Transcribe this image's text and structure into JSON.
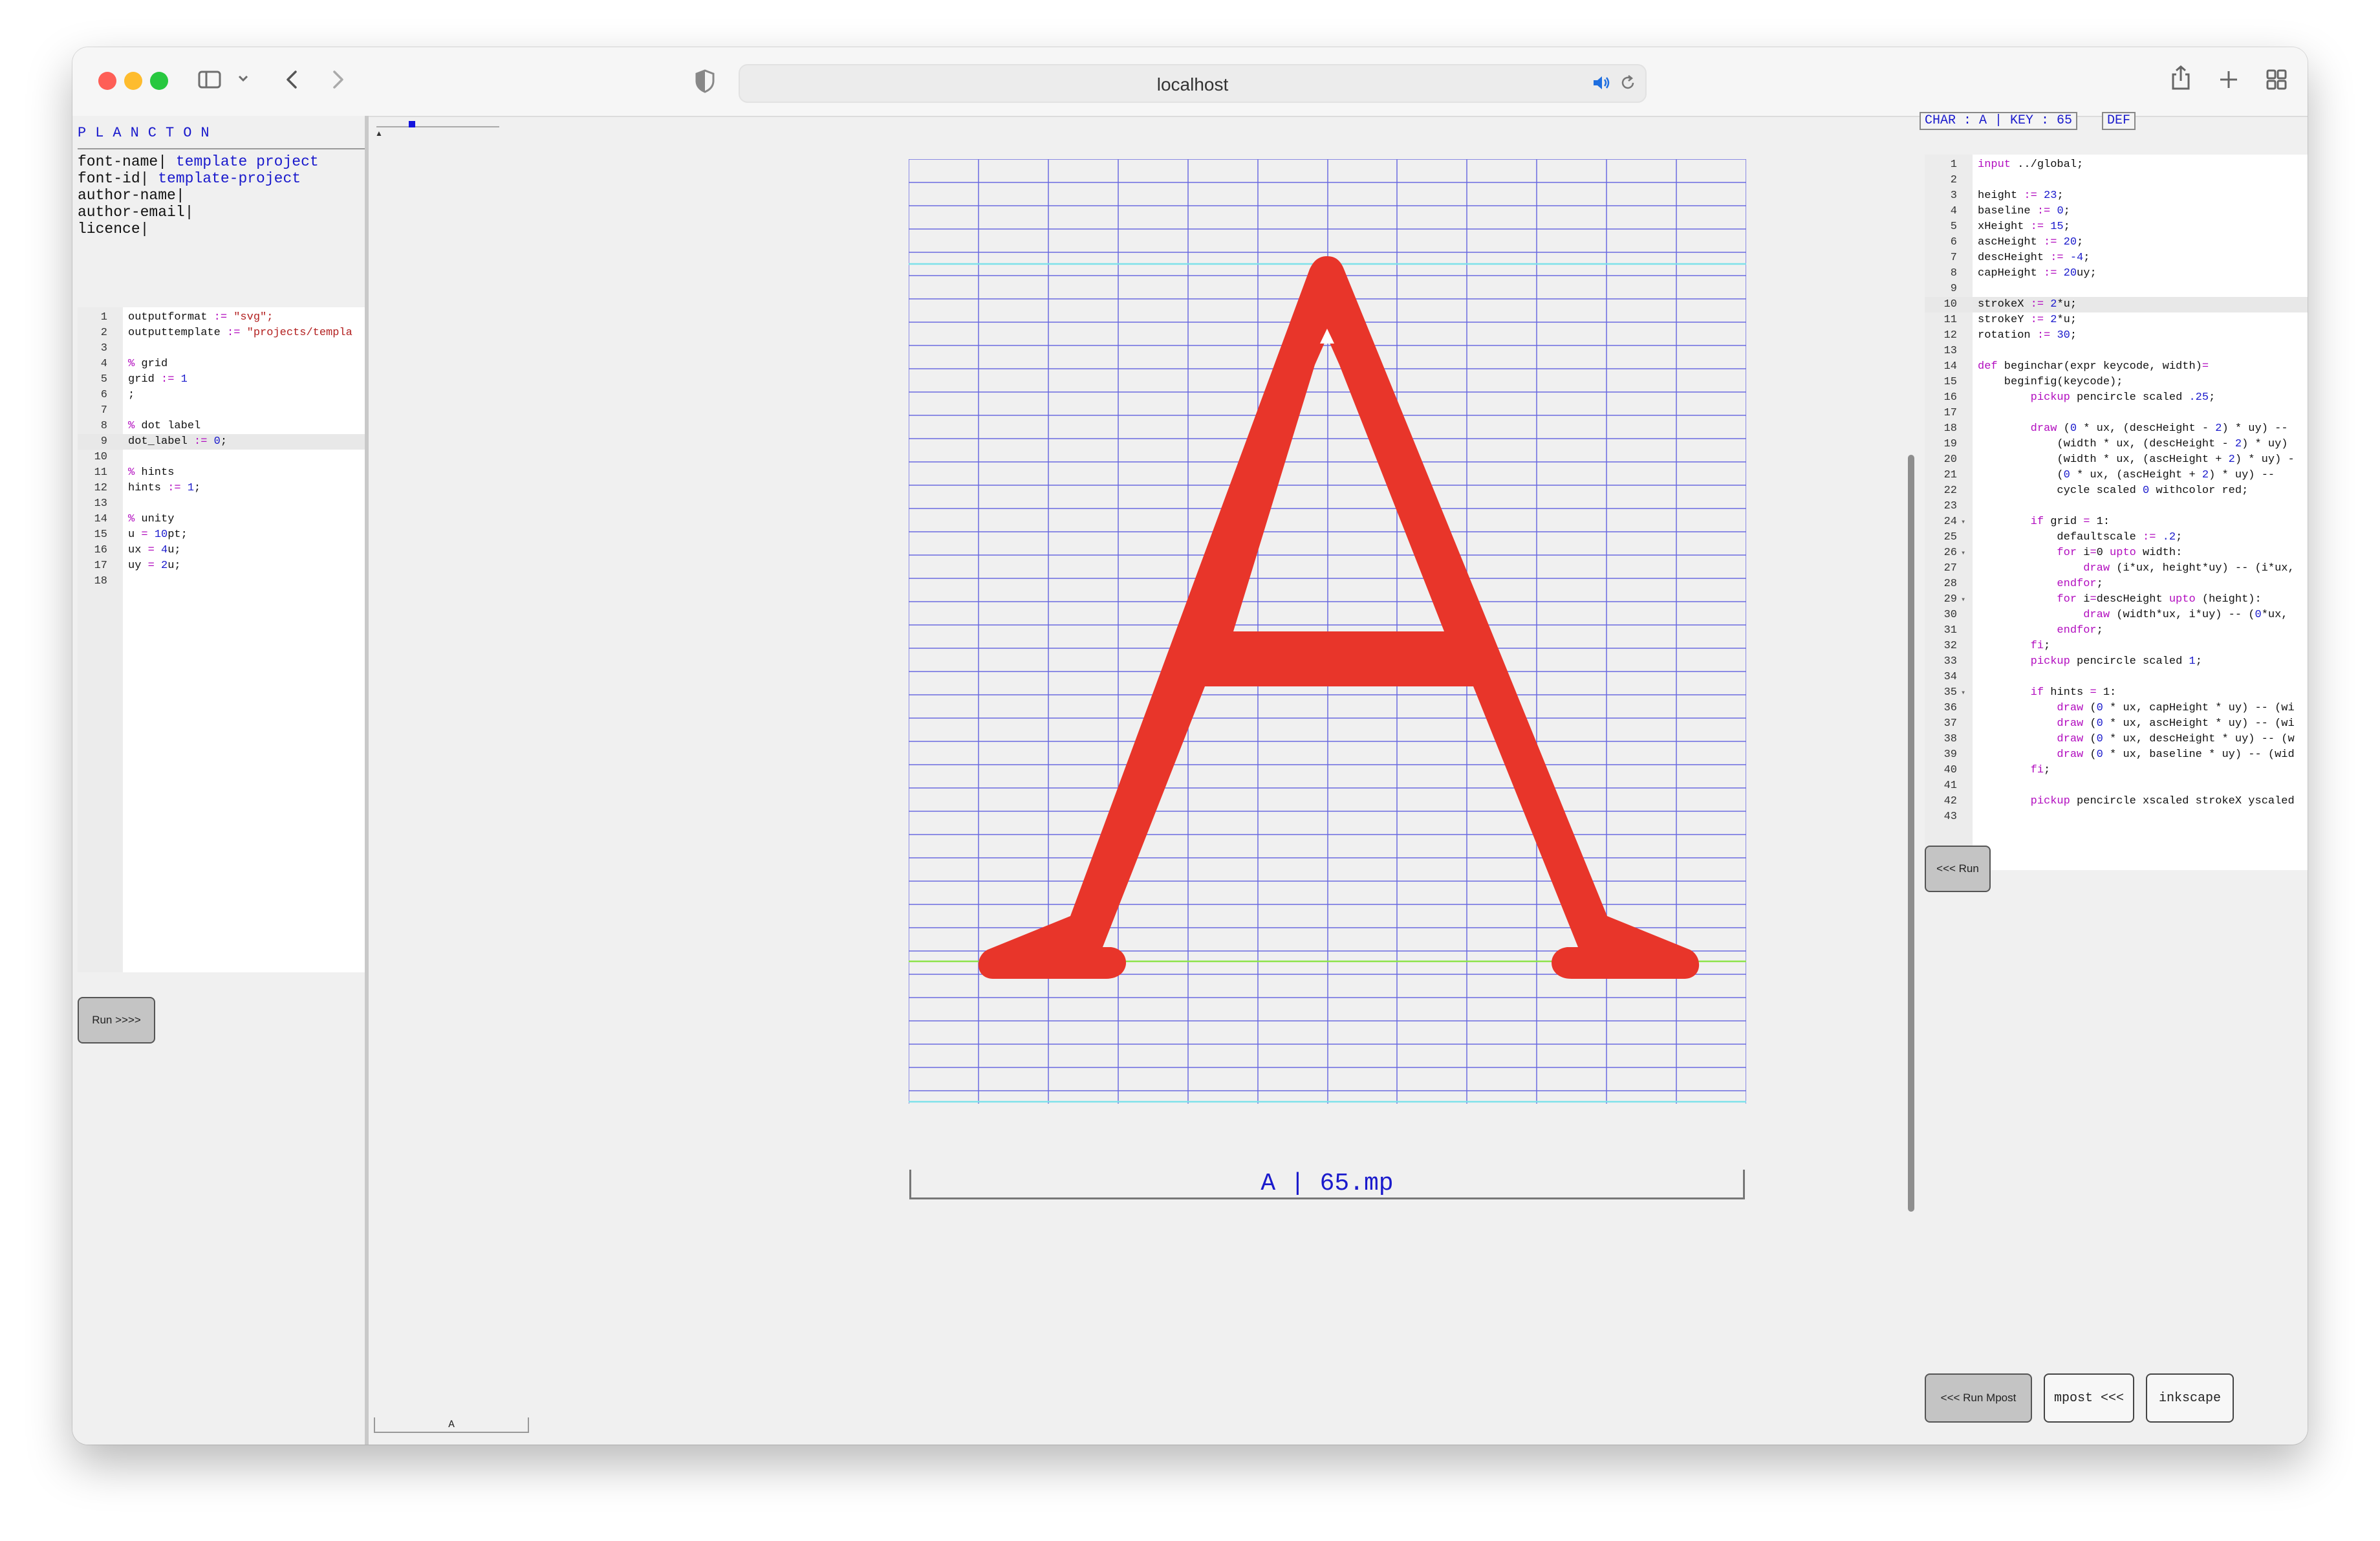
{
  "browser": {
    "url": "localhost",
    "icons": [
      "sidebar-icon",
      "chevron-down-icon",
      "back-icon",
      "forward-icon",
      "shield-icon",
      "audio-icon",
      "reload-icon",
      "share-icon",
      "new-tab-icon",
      "tabs-overview-icon"
    ]
  },
  "app": {
    "brand": "PLANCTON",
    "meta": [
      {
        "key": "font-name|",
        "value": "template project"
      },
      {
        "key": "font-id|",
        "value": "template-project"
      },
      {
        "key": "author-name|",
        "value": ""
      },
      {
        "key": "author-email|",
        "value": ""
      },
      {
        "key": "licence|",
        "value": ""
      }
    ]
  },
  "left_editor": {
    "lines": [
      "outputformat := \"svg\";",
      "outputtemplate := \"projects/templa",
      "",
      "% grid",
      "grid := 1",
      ";",
      "",
      "% dot label",
      "dot_label := 0;",
      "",
      "% hints",
      "hints := 1;",
      "",
      "% unity",
      "u = 10pt;",
      "ux = 4u;",
      "uy = 2u;",
      ""
    ],
    "active_line": 9,
    "run_button": "Run >>>>"
  },
  "center": {
    "glyph": "A",
    "file_label": "A | 65.mp",
    "bottom_tab": "A",
    "colors": {
      "glyph": "#e8352a",
      "grid": "#6a6ae0",
      "hint_cyan": "#7ee2ea",
      "baseline_green": "#8de34a"
    }
  },
  "right_panel": {
    "char_label": "CHAR : A | KEY : 65",
    "def_label": "DEF",
    "lines": [
      "input ../global;",
      "",
      "height := 23;",
      "baseline := 0;",
      "xHeight := 15;",
      "ascHeight := 20;",
      "descHeight := -4;",
      "capHeight := 20uy;",
      "",
      "strokeX := 2*u;",
      "strokeY := 2*u;",
      "rotation := 30;",
      "",
      "def beginchar(expr keycode, width)=",
      "    beginfig(keycode);",
      "        pickup pencircle scaled .25;",
      "",
      "        draw (0 * ux, (descHeight - 2) * uy) --",
      "            (width * ux, (descHeight - 2) * uy)",
      "            (width * ux, (ascHeight + 2) * uy) -",
      "            (0 * ux, (ascHeight + 2) * uy) --",
      "            cycle scaled 0 withcolor red;",
      "",
      "        if grid = 1:",
      "            defaultscale := .2;",
      "            for i=0 upto width:",
      "                draw (i*ux, height*uy) -- (i*ux,",
      "            endfor;",
      "            for i=descHeight upto (height):",
      "                draw (width*ux, i*uy) -- (0*ux,",
      "            endfor;",
      "        fi;",
      "        pickup pencircle scaled 1;",
      "",
      "        if hints = 1:",
      "            draw (0 * ux, capHeight * uy) -- (wi",
      "            draw (0 * ux, ascHeight * uy) -- (wi",
      "            draw (0 * ux, descHeight * uy) -- (w",
      "            draw (0 * ux, baseline * uy) -- (wid",
      "        fi;",
      "",
      "        pickup pencircle xscaled strokeX yscaled",
      ""
    ],
    "active_line": 10,
    "fold_lines": [
      24,
      26,
      29,
      35
    ],
    "run_button": "<<< Run",
    "run_mpost_button": "<<< Run Mpost",
    "mpost_button": "mpost <<<",
    "inkscape_button": "inkscape"
  }
}
